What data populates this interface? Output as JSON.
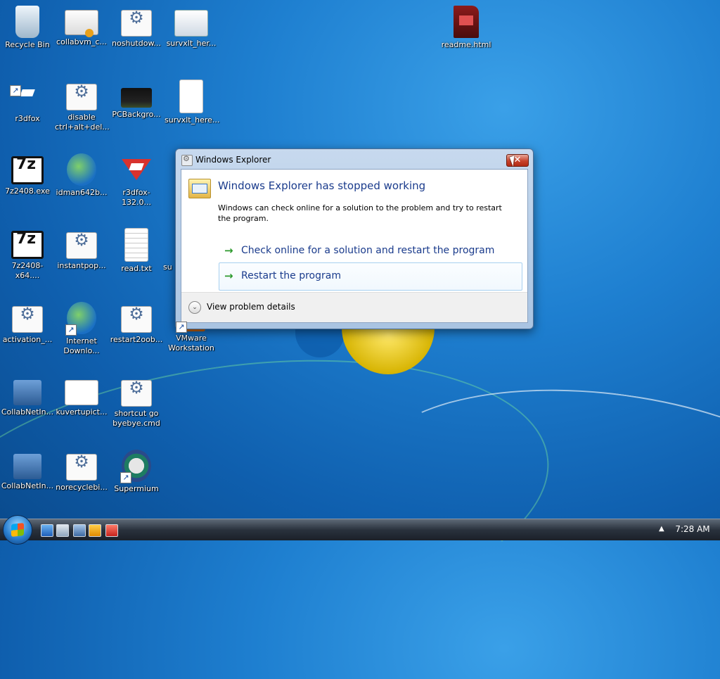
{
  "desktop": {
    "icons": [
      {
        "label": "Recycle Bin"
      },
      {
        "label": "collabvm_c..."
      },
      {
        "label": "noshutdow..."
      },
      {
        "label": "survxlt_her..."
      },
      {
        "label": "readme.html"
      },
      {
        "label": "r3dfox"
      },
      {
        "label": "disable\nctrl+alt+del..."
      },
      {
        "label": "PCBackgro..."
      },
      {
        "label": "survxlt_here..."
      },
      {
        "label": "7z2408.exe"
      },
      {
        "label": "idman642b..."
      },
      {
        "label": "r3dfox-132.0..."
      },
      {
        "label": "7z2408-x64...."
      },
      {
        "label": "instantpop..."
      },
      {
        "label": "read.txt"
      },
      {
        "label": "su"
      },
      {
        "label": "activation_..."
      },
      {
        "label": "Internet\nDownlo..."
      },
      {
        "label": "restart2oob..."
      },
      {
        "label": "VMware\nWorkstation"
      },
      {
        "label": "CollabNetIn..."
      },
      {
        "label": "kuvertupict..."
      },
      {
        "label": "shortcut go\nbyebye.cmd"
      },
      {
        "label": "CollabNetIn..."
      },
      {
        "label": "norecyclebi..."
      },
      {
        "label": "Supermium"
      }
    ]
  },
  "dialog": {
    "title": "Windows Explorer",
    "close_label": "✕",
    "main_instruction": "Windows Explorer has stopped working",
    "content": "Windows can check online for a solution to the problem and try to restart the program.",
    "options": [
      {
        "label": "Check online for a solution and restart the program"
      },
      {
        "label": "Restart the program"
      }
    ],
    "details_label": "View problem details"
  },
  "taskbar": {
    "clock": "7:28 AM",
    "tray_arrow": "▲"
  },
  "icons": {
    "arrow": "→",
    "chevron": "⌄"
  }
}
